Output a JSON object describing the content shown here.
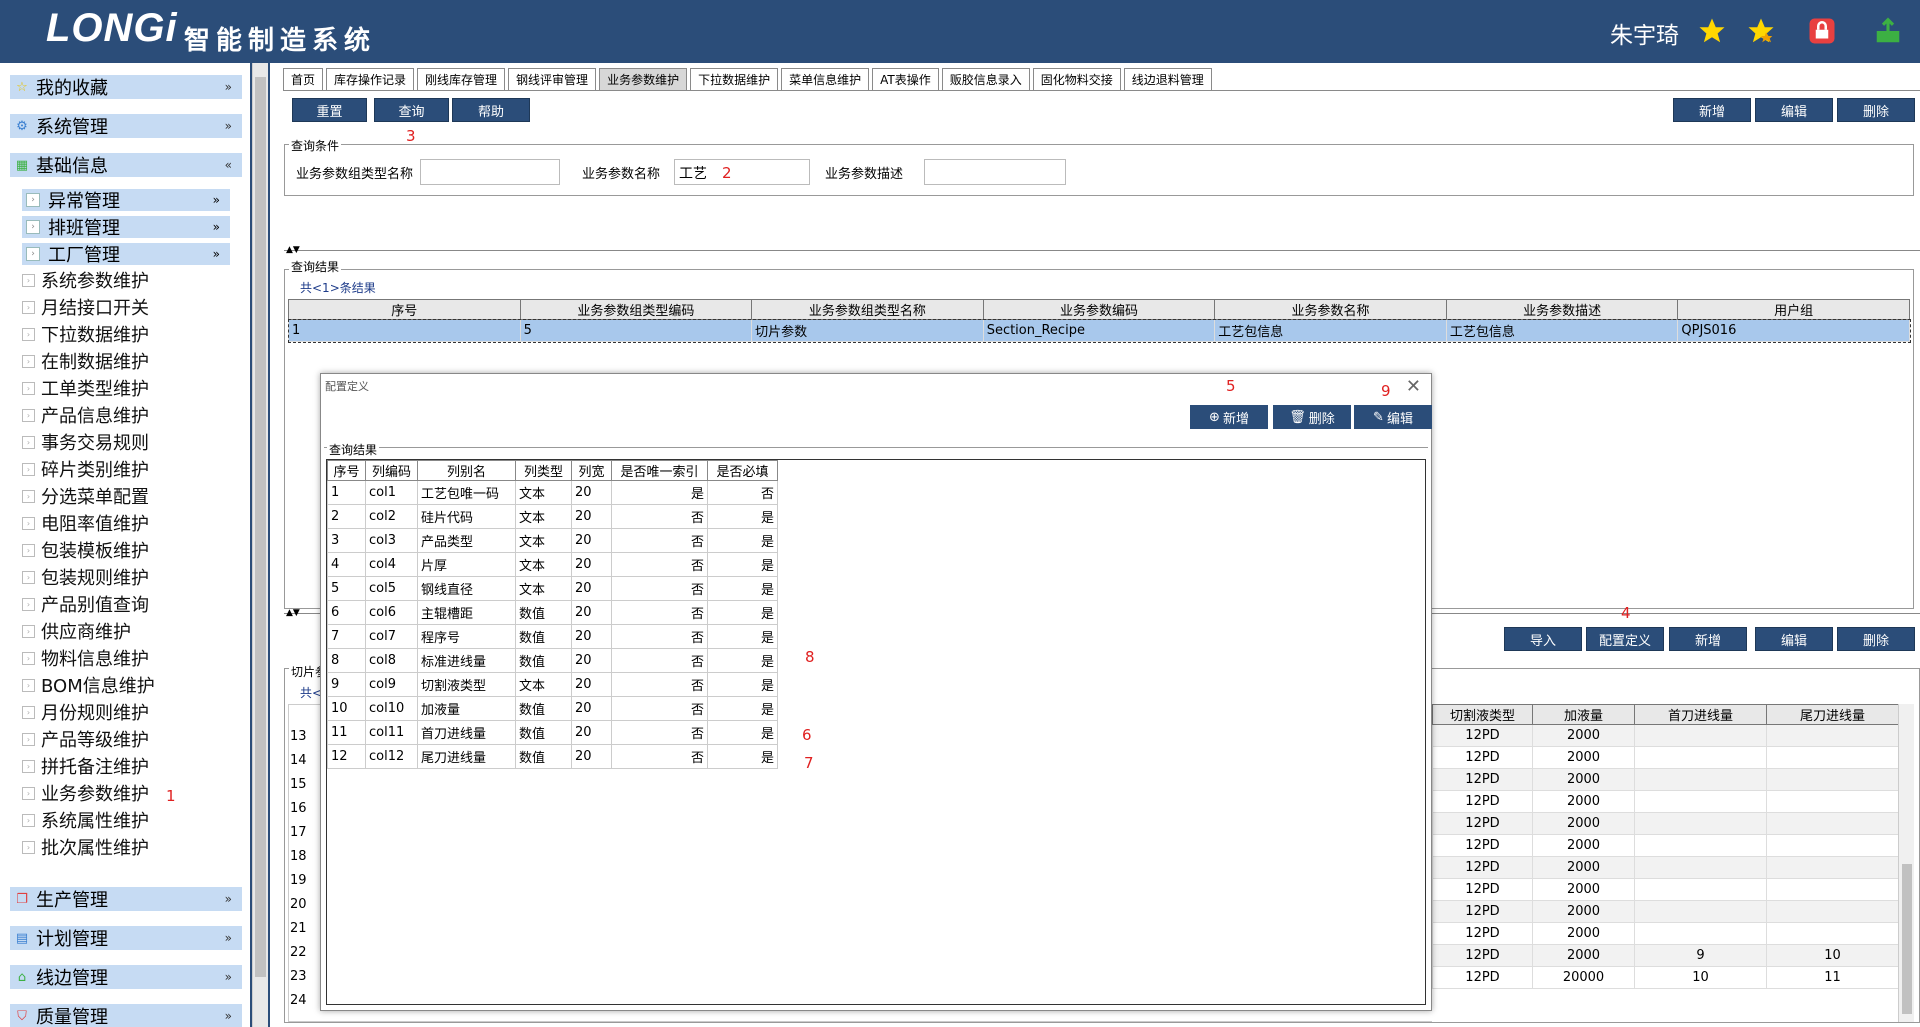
{
  "header": {
    "logo": "LONGi",
    "system_name": "智能制造系统",
    "user": "朱宇琦"
  },
  "sidebar": {
    "sections_top": [
      {
        "label": "我的收藏",
        "icon": "star-icon"
      },
      {
        "label": "系统管理",
        "icon": "gear-icon"
      },
      {
        "label": "基础信息",
        "icon": "grid-icon"
      }
    ],
    "subgroups": [
      "异常管理",
      "排班管理",
      "工厂管理"
    ],
    "items": [
      "系统参数维护",
      "月结接口开关",
      "下拉数据维护",
      "在制数据维护",
      "工单类型维护",
      "产品信息维护",
      "事务交易规则",
      "碎片类别维护",
      "分选菜单配置",
      "电阻率值维护",
      "包装模板维护",
      "包装规则维护",
      "产品别值查询",
      "供应商维护",
      "物料信息维护",
      "BOM信息维护",
      "月份规则维护",
      "产品等级维护",
      "拼托备注维护",
      "业务参数维护",
      "系统属性维护",
      "批次属性维护"
    ],
    "sections_bottom": [
      {
        "label": "生产管理",
        "icon": "copy-icon"
      },
      {
        "label": "计划管理",
        "icon": "calendar-icon"
      },
      {
        "label": "线边管理",
        "icon": "home-icon"
      },
      {
        "label": "质量管理",
        "icon": "shield-icon"
      }
    ],
    "marker_1": "1"
  },
  "tabs": [
    "首页",
    "库存操作记录",
    "刚线库存管理",
    "钢线评审管理",
    "业务参数维护",
    "下拉数据维护",
    "菜单信息维护",
    "AT表操作",
    "贩胶信息录入",
    "固化物料交接",
    "线边退料管理"
  ],
  "active_tab": "业务参数维护",
  "toolbar": {
    "reset": "重置",
    "query": "查询",
    "help": "帮助",
    "add": "新增",
    "edit": "编辑",
    "delete": "删除",
    "marker_3": "3"
  },
  "query": {
    "title": "查询条件",
    "group_type_label": "业务参数组类型名称",
    "group_type_value": "",
    "param_name_label": "业务参数名称",
    "param_name_value": "工艺",
    "marker_2": "2",
    "param_desc_label": "业务参数描述",
    "param_desc_value": ""
  },
  "results": {
    "title": "查询结果",
    "count": "共<1>条结果",
    "columns": [
      "序号",
      "业务参数组类型编码",
      "业务参数组类型名称",
      "业务参数编码",
      "业务参数名称",
      "业务参数描述",
      "用户组"
    ],
    "row": [
      "1",
      "5",
      "切片参数",
      "Section_Recipe",
      "工艺包信息",
      "工艺包信息",
      "QPJS016"
    ]
  },
  "lower": {
    "title": "切片参",
    "count": "共<",
    "buttons": {
      "import": "导入",
      "config": "配置定义",
      "add": "新增",
      "edit": "编辑",
      "delete": "删除"
    },
    "marker_4": "4",
    "columns_right": [
      "切割液类型",
      "加液量",
      "首刀进线量",
      "尾刀进线量"
    ],
    "rows": [
      {
        "no": "13",
        "type": "12PD",
        "amount": "2000",
        "first": "",
        "last": ""
      },
      {
        "no": "14",
        "type": "12PD",
        "amount": "2000",
        "first": "",
        "last": ""
      },
      {
        "no": "15",
        "type": "12PD",
        "amount": "2000",
        "first": "",
        "last": ""
      },
      {
        "no": "16",
        "type": "12PD",
        "amount": "2000",
        "first": "",
        "last": ""
      },
      {
        "no": "17",
        "type": "12PD",
        "amount": "2000",
        "first": "",
        "last": ""
      },
      {
        "no": "18",
        "type": "12PD",
        "amount": "2000",
        "first": "",
        "last": ""
      },
      {
        "no": "19",
        "type": "12PD",
        "amount": "2000",
        "first": "",
        "last": ""
      },
      {
        "no": "20",
        "type": "12PD",
        "amount": "2000",
        "first": "",
        "last": ""
      },
      {
        "no": "21",
        "type": "12PD",
        "amount": "2000",
        "first": "",
        "last": ""
      },
      {
        "no": "22",
        "type": "12PD",
        "amount": "2000",
        "first": "",
        "last": ""
      },
      {
        "no": "23",
        "type": "12PD",
        "amount": "2000",
        "first": "9",
        "last": "10"
      },
      {
        "no": "24",
        "type": "12PD",
        "amount": "20000",
        "first": "10",
        "last": "11"
      }
    ]
  },
  "dialog": {
    "title": "配置定义",
    "add": "新增",
    "delete": "删除",
    "edit": "编辑",
    "marker_5": "5",
    "marker_9": "9",
    "marker_8": "8",
    "marker_6": "6",
    "marker_7": "7",
    "results_title": "查询结果",
    "columns": [
      "序号",
      "列编码",
      "列别名",
      "列类型",
      "列宽",
      "是否唯一索引",
      "是否必填"
    ],
    "rows": [
      [
        "1",
        "col1",
        "工艺包唯一码",
        "文本",
        "20",
        "是",
        "否"
      ],
      [
        "2",
        "col2",
        "硅片代码",
        "文本",
        "20",
        "否",
        "是"
      ],
      [
        "3",
        "col3",
        "产品类型",
        "文本",
        "20",
        "否",
        "是"
      ],
      [
        "4",
        "col4",
        "片厚",
        "文本",
        "20",
        "否",
        "是"
      ],
      [
        "5",
        "col5",
        "钢线直径",
        "文本",
        "20",
        "否",
        "是"
      ],
      [
        "6",
        "col6",
        "主辊槽距",
        "数值",
        "20",
        "否",
        "是"
      ],
      [
        "7",
        "col7",
        "程序号",
        "数值",
        "20",
        "否",
        "是"
      ],
      [
        "8",
        "col8",
        "标准进线量",
        "数值",
        "20",
        "否",
        "是"
      ],
      [
        "9",
        "col9",
        "切割液类型",
        "文本",
        "20",
        "否",
        "是"
      ],
      [
        "10",
        "col10",
        "加液量",
        "数值",
        "20",
        "否",
        "是"
      ],
      [
        "11",
        "col11",
        "首刀进线量",
        "数值",
        "20",
        "否",
        "是"
      ],
      [
        "12",
        "col12",
        "尾刀进线量",
        "数值",
        "20",
        "否",
        "是"
      ]
    ]
  }
}
